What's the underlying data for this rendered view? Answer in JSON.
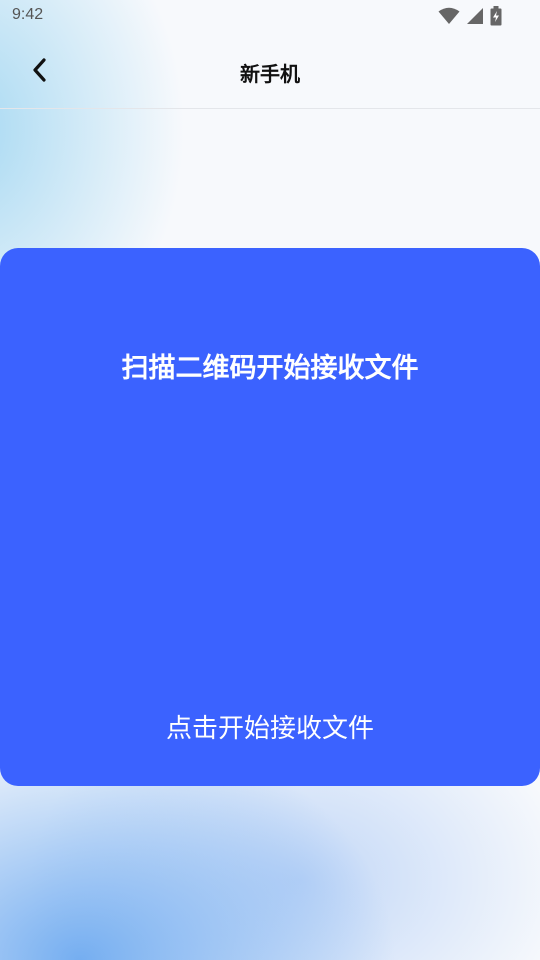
{
  "status_bar": {
    "time": "9:42",
    "icons": [
      "wifi-icon",
      "signal-icon",
      "battery-charging-icon"
    ]
  },
  "nav": {
    "back_icon": "chevron-left-icon",
    "title": "新手机"
  },
  "card": {
    "title": "扫描二维码开始接收文件",
    "action_label": "点击开始接收文件",
    "background": "#3b62ff",
    "text_color": "#ffffff"
  }
}
